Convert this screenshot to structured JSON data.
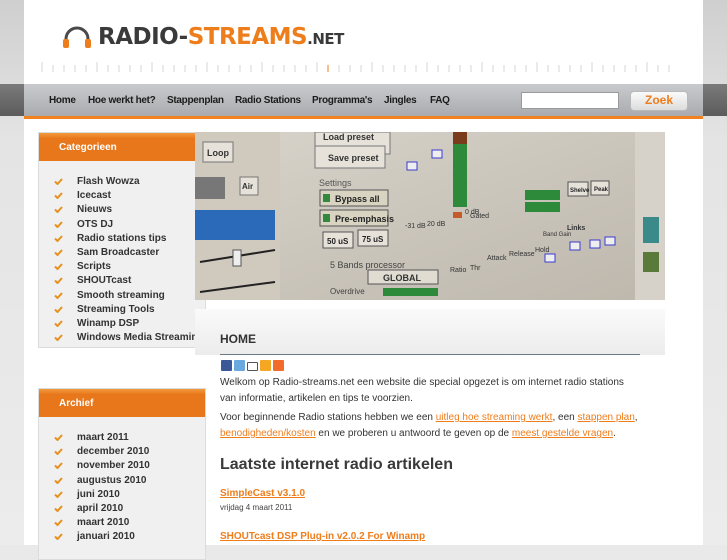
{
  "header": {
    "logo": {
      "part1": "RADIO-",
      "part2": "STREAMS",
      "part3": ".NET"
    }
  },
  "nav": {
    "items": [
      {
        "label": "Home"
      },
      {
        "label": "Hoe werkt het?"
      },
      {
        "label": "Stappenplan"
      },
      {
        "label": "Radio Stations"
      },
      {
        "label": "Programma's"
      },
      {
        "label": "Jingles"
      },
      {
        "label": "FAQ"
      }
    ],
    "search": {
      "value": "",
      "button_label": "Zoek"
    }
  },
  "sidebar": {
    "categories": {
      "title": "Categorieen",
      "items": [
        "Flash Wowza",
        "Icecast",
        "Nieuws",
        "OTS DJ",
        "Radio stations tips",
        "Sam Broadcaster",
        "Scripts",
        "SHOUTcast",
        "Smooth streaming",
        "Streaming Tools",
        "Winamp DSP",
        "Windows Media Streaming"
      ]
    },
    "archive": {
      "title": "Archief",
      "items": [
        "maart 2011",
        "december 2010",
        "november 2010",
        "augustus 2010",
        "juni 2010",
        "april 2010",
        "maart 2010",
        "januari 2010"
      ]
    }
  },
  "banner": {
    "labels": [
      "Load preset",
      "Save preset",
      "Settings",
      "Bypass all",
      "Pre-emphasis",
      "50 uS",
      "75 uS",
      "5 Bands processor",
      "GLOBAL",
      "Overdrive",
      "Loop",
      "Air",
      "-31 dB",
      "20 dB",
      "0 dB",
      "Gated",
      "Shelve",
      "Peak",
      "Links",
      "Ratio",
      "Thr",
      "Attack",
      "Release",
      "Hold",
      "Band Gain"
    ]
  },
  "main": {
    "title": "HOME",
    "share_icons": [
      "facebook-icon",
      "twitter-icon",
      "print-icon",
      "hyves-icon",
      "addthis-icon"
    ],
    "intro": "Welkom op Radio-streams.net een website die special opgezet is om internet radio stations van informatie, artikelen en tips te voorzien.",
    "para2": {
      "t1": "Voor beginnende Radio stations hebben we een ",
      "l1": "uitleg hoe streaming werkt",
      "t2": ", een ",
      "l2": "stappen plan",
      "t3": ", ",
      "l3": "benodigheden/kosten",
      "t4": " en we proberen u antwoord te geven op de ",
      "l4": "meest gestelde vragen",
      "t5": "."
    },
    "articles_heading": "Laatste internet radio artikelen",
    "articles": [
      {
        "title": "SimpleCast v3.1.0",
        "date": "vrijdag 4 maart 2011"
      },
      {
        "title": "SHOUTcast DSP Plug-in v2.0.2 For Winamp",
        "date": ""
      }
    ]
  }
}
